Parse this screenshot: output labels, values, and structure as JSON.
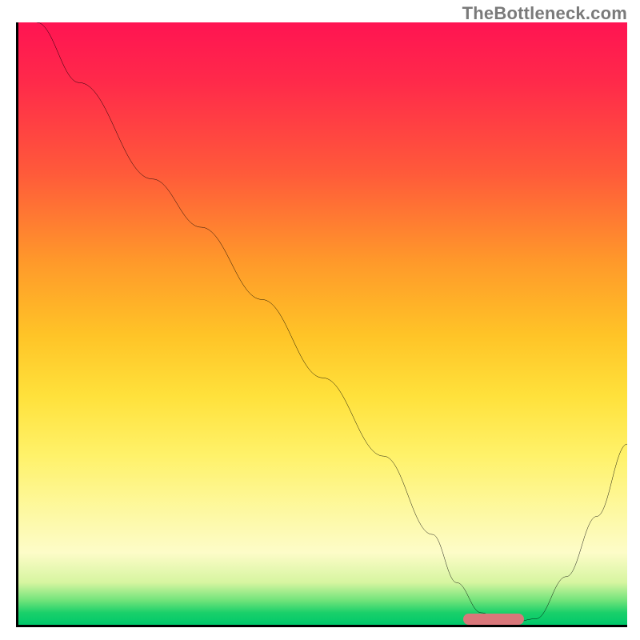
{
  "watermark": "TheBottleneck.com",
  "colors": {
    "gradient_top": "#ff1452",
    "gradient_mid": "#ffe13b",
    "gradient_bottom": "#00c86a",
    "curve": "#000000",
    "marker": "#d9777a",
    "axis": "#000000"
  },
  "chart_data": {
    "type": "line",
    "title": "",
    "xlabel": "",
    "ylabel": "",
    "xlim": [
      0,
      100
    ],
    "ylim": [
      0,
      100
    ],
    "grid": false,
    "legend": false,
    "series": [
      {
        "name": "bottleneck-curve",
        "x": [
          3,
          10,
          22,
          30,
          40,
          50,
          60,
          68,
          72,
          76,
          80,
          85,
          90,
          95,
          100
        ],
        "values": [
          100,
          90,
          74,
          66,
          54,
          41,
          28,
          15,
          7,
          2,
          0,
          1,
          8,
          18,
          30
        ]
      }
    ],
    "annotations": [
      {
        "name": "optimal-range-marker",
        "x_start": 73,
        "x_end": 83,
        "y": 0
      }
    ],
    "notes": "Values are estimated from unlabeled axes; y=0 is the bottom axis (best / no bottleneck), y=100 is the top edge."
  }
}
